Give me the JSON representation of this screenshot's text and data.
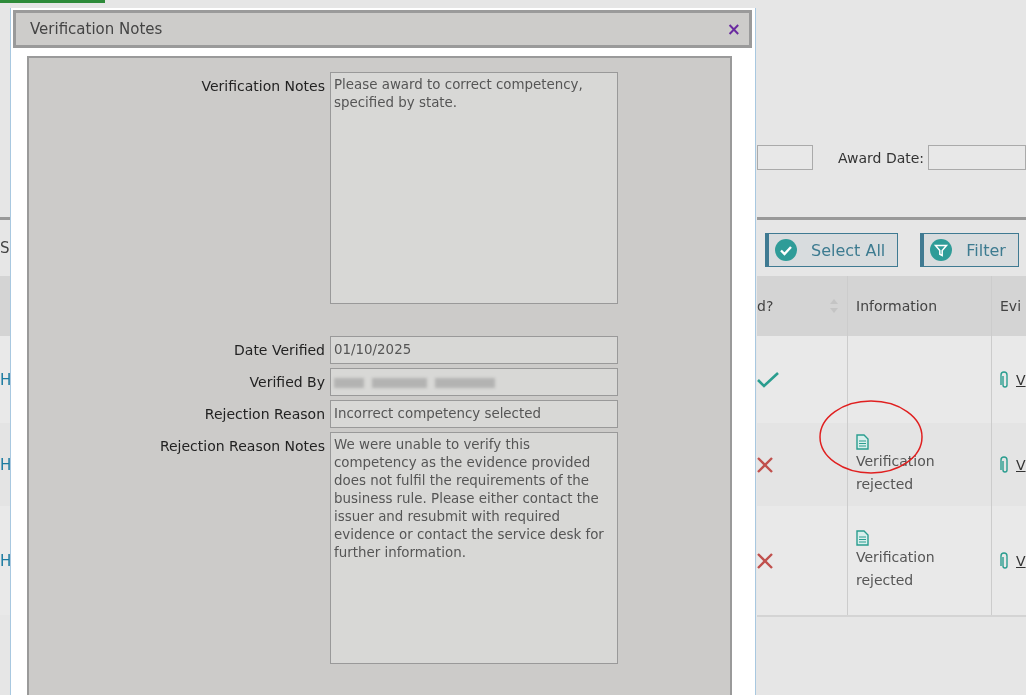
{
  "page": {
    "award_date_label": "Award Date:",
    "toolbar_fragment": "S",
    "buttons": [
      {
        "kind": "select",
        "label": "Select All"
      },
      {
        "kind": "filter",
        "label": "Filter"
      }
    ],
    "table": {
      "columns": [
        {
          "right": "d?",
          "sortable": true
        },
        {
          "label": "Information"
        },
        {
          "label": "Evi"
        }
      ],
      "rows": [
        {
          "col1_fragment": "H",
          "verified": true,
          "information": null,
          "evidence": "V"
        },
        {
          "col1_fragment": "H",
          "verified": false,
          "information": "Verification rejected",
          "evidence": "V",
          "highlighted": true
        },
        {
          "col1_fragment": "H",
          "verified": false,
          "information": "Verification rejected",
          "evidence": "V",
          "highlighted": false
        }
      ]
    }
  },
  "dialog": {
    "title": "Verification Notes",
    "close": "×",
    "fields": [
      {
        "kind": "multiline",
        "label": "Verification Notes",
        "value": "Please award to correct competency, specified by state."
      },
      {
        "kind": "single",
        "label": "Date Verified",
        "value": "01/10/2025"
      },
      {
        "kind": "redacted",
        "label": "Verified By"
      },
      {
        "kind": "single",
        "label": "Rejection Reason",
        "value": "Incorrect competency selected"
      },
      {
        "kind": "multiline",
        "label": "Rejection Reason Notes",
        "value": "We were unable to verify this competency as the evidence provided does not fulfil the requirements of the business rule. Please either contact the issuer and resubmit with required evidence or contact the service desk for further information."
      }
    ]
  }
}
